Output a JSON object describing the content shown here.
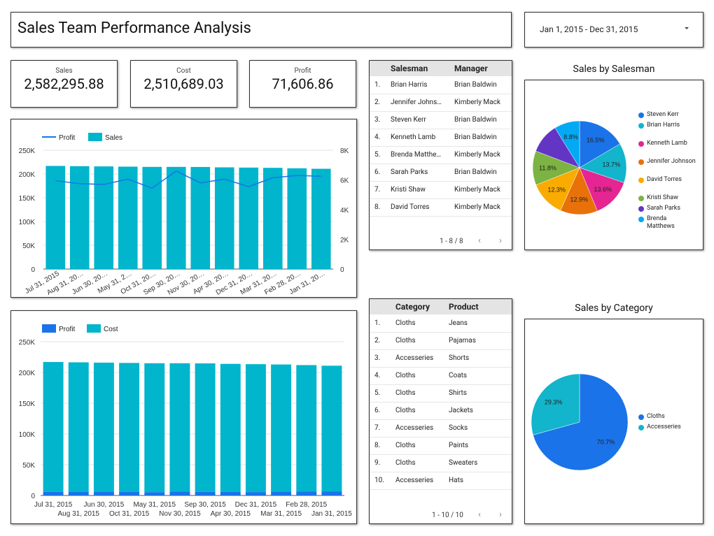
{
  "header": {
    "title": "Sales Team Performance Analysis",
    "date_range": "Jan 1, 2015 - Dec 31, 2015"
  },
  "kpis": [
    {
      "label": "Sales",
      "value": "2,582,295.88"
    },
    {
      "label": "Cost",
      "value": "2,510,689.03"
    },
    {
      "label": "Profit",
      "value": "71,606.86"
    }
  ],
  "salesman_table": {
    "columns": [
      "Salesman",
      "Manager"
    ],
    "rows": [
      {
        "n": "1.",
        "a": "Brian Harris",
        "b": "Brian Baldwin"
      },
      {
        "n": "2.",
        "a": "Jennifer Johns…",
        "b": "Kimberly Mack"
      },
      {
        "n": "3.",
        "a": "Steven Kerr",
        "b": "Brian Baldwin"
      },
      {
        "n": "4.",
        "a": "Kenneth Lamb",
        "b": "Brian Baldwin"
      },
      {
        "n": "5.",
        "a": "Brenda Matthe…",
        "b": "Kimberly Mack"
      },
      {
        "n": "6.",
        "a": "Sarah Parks",
        "b": "Brian Baldwin"
      },
      {
        "n": "7.",
        "a": "Kristi Shaw",
        "b": "Kimberly Mack"
      },
      {
        "n": "8.",
        "a": "David Torres",
        "b": "Kimberly Mack"
      }
    ],
    "pager": "1 - 8 / 8"
  },
  "category_table": {
    "columns": [
      "Category",
      "Product"
    ],
    "rows": [
      {
        "n": "1.",
        "a": "Cloths",
        "b": "Jeans"
      },
      {
        "n": "2.",
        "a": "Cloths",
        "b": "Pajamas"
      },
      {
        "n": "3.",
        "a": "Accesseries",
        "b": "Shorts"
      },
      {
        "n": "4.",
        "a": "Cloths",
        "b": "Coats"
      },
      {
        "n": "5.",
        "a": "Cloths",
        "b": "Shirts"
      },
      {
        "n": "6.",
        "a": "Cloths",
        "b": "Jackets"
      },
      {
        "n": "7.",
        "a": "Accesseries",
        "b": "Socks"
      },
      {
        "n": "8.",
        "a": "Cloths",
        "b": "Paints"
      },
      {
        "n": "9.",
        "a": "Cloths",
        "b": "Sweaters"
      },
      {
        "n": "10.",
        "a": "Accesseries",
        "b": "Hats"
      }
    ],
    "pager": "1 - 10 / 10"
  },
  "pager_icons": {
    "prev": "‹",
    "next": "›"
  },
  "colors": {
    "sales": "#00b5cc",
    "profit_line": "#1a73e8",
    "profit_bar": "#1a73e8",
    "cost": "#00b5cc"
  },
  "chart_data": [
    {
      "id": "sales_profit",
      "type": "bar",
      "categories": [
        "Jul 31, 2015",
        "Aug 31, 20…",
        "Jun 30, 20…",
        "May 31, 2…",
        "Oct 31, 20…",
        "Sep 30, 20…",
        "Nov 30, 20…",
        "Apr 30, 20…",
        "Dec 31, 20…",
        "Mar 31, 20…",
        "Feb 28, 20…",
        "Jan 31, 20…"
      ],
      "series": [
        {
          "name": "Sales",
          "type": "bar",
          "axis": "left",
          "values": [
            217000,
            216500,
            216000,
            215500,
            215000,
            215000,
            214800,
            214000,
            213500,
            213000,
            212000,
            211000
          ]
        },
        {
          "name": "Profit",
          "type": "line",
          "axis": "right",
          "values": [
            5950,
            5750,
            5700,
            6050,
            5450,
            6600,
            5800,
            6050,
            5550,
            6150,
            6300,
            6250
          ]
        }
      ],
      "legend": [
        "Profit",
        "Sales"
      ],
      "y_left_ticks": [
        "0",
        "50K",
        "100K",
        "150K",
        "200K",
        "250K"
      ],
      "ylim_left": [
        0,
        250000
      ],
      "y_right_ticks": [
        "0",
        "2K",
        "4K",
        "6K",
        "8K"
      ],
      "ylim_right": [
        0,
        8000
      ]
    },
    {
      "id": "profit_cost",
      "type": "bar",
      "stacked": true,
      "categories": [
        "Jul 31, 2015",
        "Aug 31, 2015",
        "Jun 30, 2015",
        "Oct 31, 2015",
        "May 31, 2015",
        "Nov 30, 2015",
        "Sep 30, 2015",
        "Apr 30, 2015",
        "Dec 31, 2015",
        "Mar 31, 2015",
        "Feb 28, 2015",
        "Jan 31, 2015"
      ],
      "series": [
        {
          "name": "Profit",
          "values": [
            5950,
            5750,
            5700,
            6050,
            5450,
            6600,
            5800,
            6050,
            5550,
            6150,
            6300,
            6250
          ]
        },
        {
          "name": "Cost",
          "values": [
            211050,
            210750,
            210300,
            209450,
            209550,
            208400,
            209000,
            207950,
            207950,
            206850,
            205700,
            204750
          ]
        }
      ],
      "legend": [
        "Profit",
        "Cost"
      ],
      "y_ticks": [
        "0",
        "50K",
        "100K",
        "150K",
        "200K",
        "250K"
      ],
      "ylim": [
        0,
        250000
      ]
    },
    {
      "id": "sales_by_salesman",
      "type": "pie",
      "title": "Sales by Salesman",
      "slices": [
        {
          "label": "Steven Kerr",
          "value": 16.5,
          "color": "#1a73e8"
        },
        {
          "label": "Brian Harris",
          "value": 13.7,
          "color": "#12b5cb"
        },
        {
          "label": "Kenneth Lamb",
          "value": 13.6,
          "color": "#e52592"
        },
        {
          "label": "Jennifer Johnson",
          "value": 12.9,
          "color": "#e8710a"
        },
        {
          "label": "David Torres",
          "value": 12.3,
          "color": "#f9ab00"
        },
        {
          "label": "Kristi Shaw",
          "value": 11.8,
          "color": "#7cb342"
        },
        {
          "label": "Sarah Parks",
          "value": 10.4,
          "color": "#6235c4"
        },
        {
          "label": "Brenda Matthews",
          "value": 8.8,
          "color": "#03a9f4"
        }
      ],
      "slice_labels": [
        "16.5%",
        "13.7%",
        "13.6%",
        "12.9%",
        "12.3%",
        "11.8%",
        "",
        "8.8%"
      ]
    },
    {
      "id": "sales_by_category",
      "type": "pie",
      "title": "Sales by Category",
      "slices": [
        {
          "label": "Cloths",
          "value": 70.7,
          "color": "#1a73e8"
        },
        {
          "label": "Accesseries",
          "value": 29.3,
          "color": "#12b5cb"
        }
      ],
      "slice_labels": [
        "70.7%",
        "29.3%"
      ]
    }
  ]
}
